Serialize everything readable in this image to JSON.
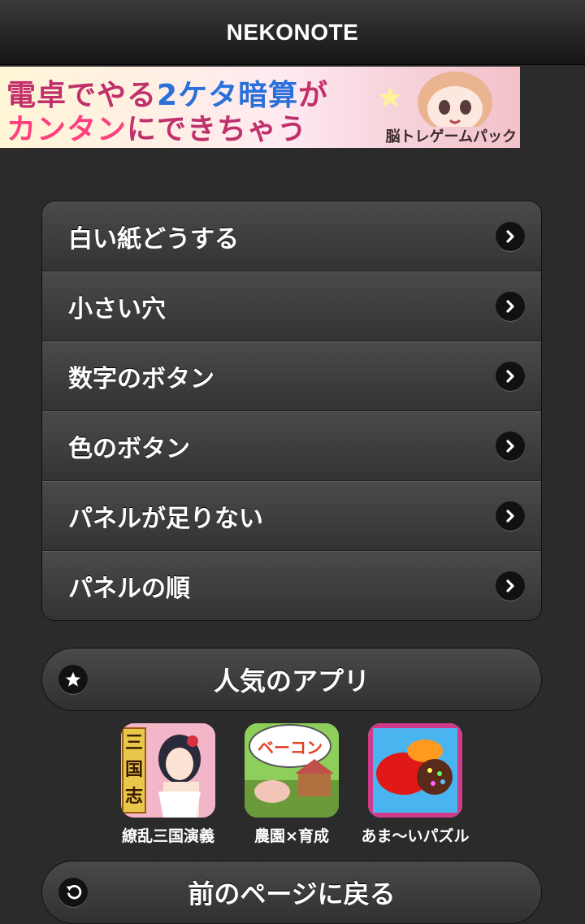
{
  "header": {
    "title": "NEKONOTE"
  },
  "banner": {
    "line1_a": "電卓でやる",
    "line1_b": "2ケタ暗算",
    "line1_c": "が",
    "line2_a": "カンタン",
    "line2_b": "にできちゃう",
    "caption": "脳トレゲームパック"
  },
  "menu": {
    "items": [
      {
        "label": "白い紙どうする"
      },
      {
        "label": "小さい穴"
      },
      {
        "label": "数字のボタン"
      },
      {
        "label": "色のボタン"
      },
      {
        "label": "パネルが足りない"
      },
      {
        "label": "パネルの順"
      }
    ]
  },
  "popular": {
    "label": "人気のアプリ",
    "icon": "star-icon"
  },
  "apps": [
    {
      "name": "繚乱三国演義",
      "icon_text": "三国志"
    },
    {
      "name": "農園×育成",
      "icon_text": "ベーコン"
    },
    {
      "name": "あま〜いパズル"
    }
  ],
  "back": {
    "label": "前のページに戻る",
    "icon": "back-arrow-icon"
  },
  "colors": {
    "background": "#2b2b2b",
    "header": "#1c1c1c",
    "text": "#ffffff"
  }
}
